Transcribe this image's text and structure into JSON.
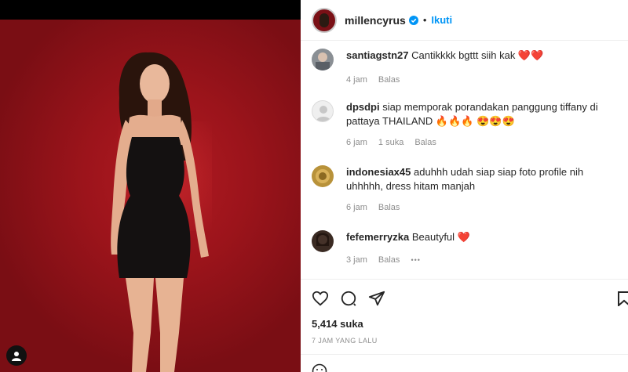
{
  "post": {
    "username": "millencyrus",
    "separator": "•",
    "follow_label": "Ikuti",
    "likes": "5,414 suka",
    "time_ago": "7 JAM YANG LALU"
  },
  "comments": [
    {
      "user": "santiagstn27",
      "text": "Cantikkkk bgttt siih kak ❤️❤️",
      "time": "4 jam",
      "likes": "",
      "reply": "Balas"
    },
    {
      "user": "dpsdpi",
      "text": "siap memporak porandakan panggung tiffany di pattaya THAILAND 🔥🔥🔥 😍😍😍",
      "time": "6 jam",
      "likes": "1 suka",
      "reply": "Balas"
    },
    {
      "user": "indonesiax45",
      "text": "aduhhh udah siap siap foto profile nih uhhhhh, dress hitam manjah",
      "time": "6 jam",
      "likes": "",
      "reply": "Balas"
    },
    {
      "user": "fefemerryzka",
      "text": "Beautyful ❤️",
      "time": "3 jam",
      "likes": "",
      "reply": "Balas",
      "more": "•••"
    }
  ],
  "icons": [
    "heart-icon",
    "comment-icon",
    "share-icon",
    "save-icon",
    "tag-user-icon",
    "verified-badge-icon",
    "emoji-icon"
  ],
  "colors": {
    "accent": "#0095f6",
    "background_red": "#9c141b",
    "heart": "#e0102a"
  }
}
